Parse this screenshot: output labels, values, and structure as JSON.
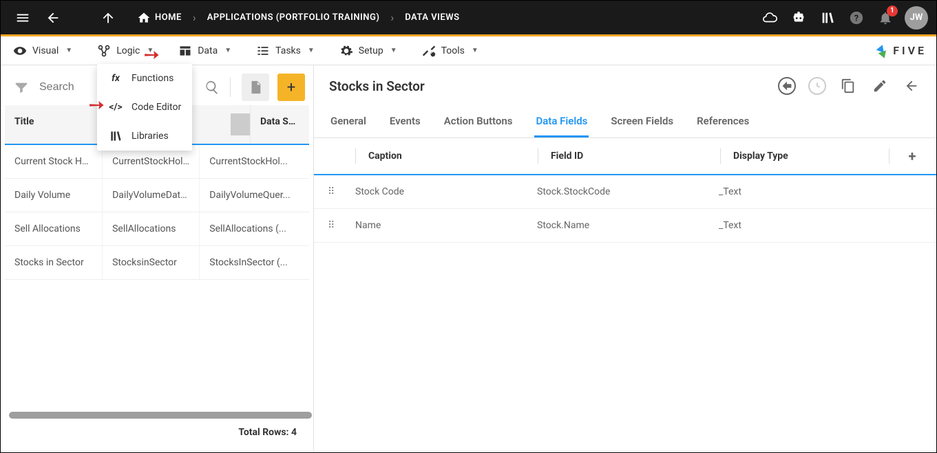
{
  "topbar": {
    "breadcrumbs": {
      "home": "HOME",
      "app": "APPLICATIONS (PORTFOLIO TRAINING)",
      "view": "DATA VIEWS"
    },
    "notifications": "1",
    "avatar": "JW"
  },
  "menus": {
    "visual": "Visual",
    "logic": "Logic",
    "data": "Data",
    "tasks": "Tasks",
    "setup": "Setup",
    "tools": "Tools"
  },
  "brand": "FIVE",
  "logic_dropdown": {
    "functions": "Functions",
    "code_editor": "Code Editor",
    "libraries": "Libraries"
  },
  "left": {
    "search_placeholder": "Search",
    "columns": {
      "title": "Title",
      "data_source": "Data Source"
    },
    "rows": [
      {
        "title": "Current Stock Ho...",
        "name": "CurrentStockHol...",
        "ds": "CurrentStockHol..."
      },
      {
        "title": "Daily Volume",
        "name": "DailyVolumeData...",
        "ds": "DailyVolumeQuer..."
      },
      {
        "title": "Sell Allocations",
        "name": "SellAllocations",
        "ds": "SellAllocations (..."
      },
      {
        "title": "Stocks in Sector",
        "name": "StocksinSector",
        "ds": "StocksInSector (..."
      }
    ],
    "footer": "Total Rows: 4"
  },
  "right": {
    "title": "Stocks in Sector",
    "tabs": {
      "general": "General",
      "events": "Events",
      "action_buttons": "Action Buttons",
      "data_fields": "Data Fields",
      "screen_fields": "Screen Fields",
      "references": "References"
    },
    "headers": {
      "caption": "Caption",
      "field_id": "Field ID",
      "display_type": "Display Type"
    },
    "rows": [
      {
        "caption": "Stock Code",
        "field_id": "Stock.StockCode",
        "display_type": "_Text"
      },
      {
        "caption": "Name",
        "field_id": "Stock.Name",
        "display_type": "_Text"
      }
    ]
  }
}
